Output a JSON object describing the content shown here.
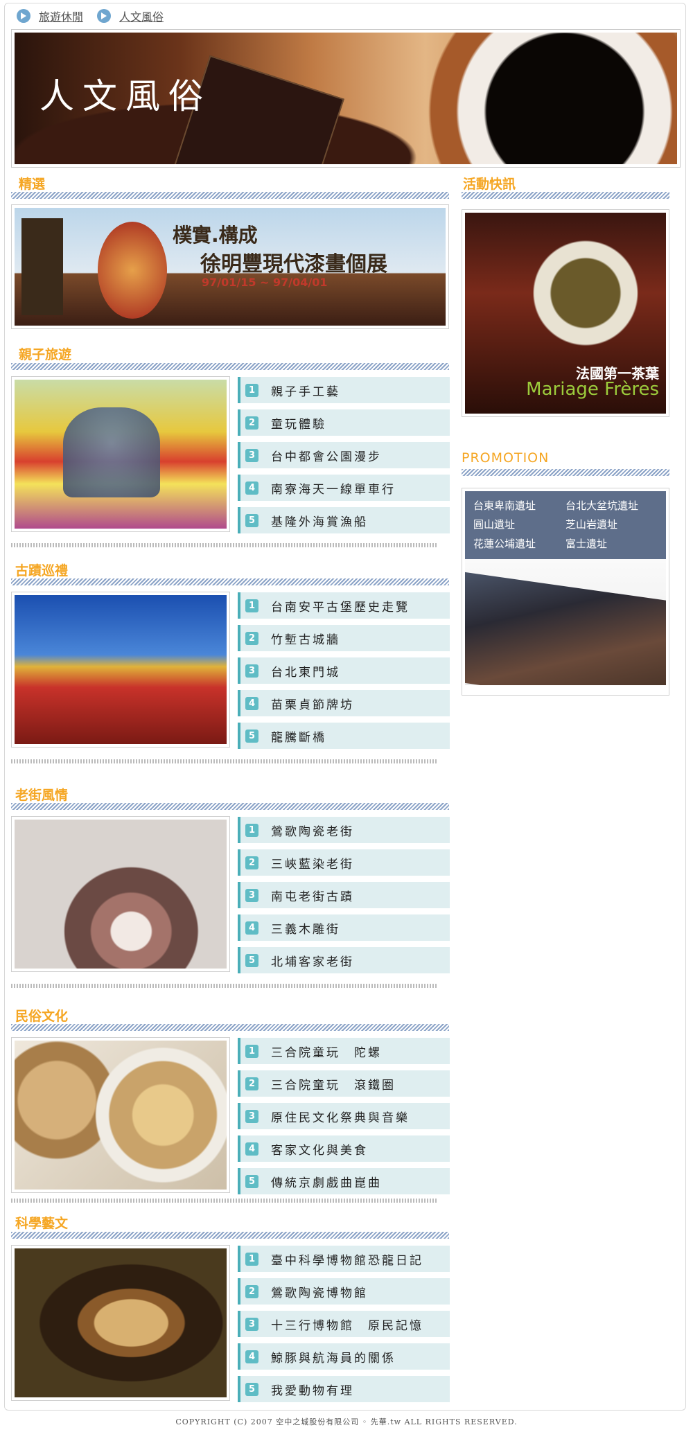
{
  "breadcrumb": {
    "items": [
      "旅遊休閒",
      "人文風俗"
    ]
  },
  "hero": {
    "title": "人文風俗"
  },
  "featured": {
    "title": "精選",
    "banner_line1": "樸實.構成",
    "banner_line2": "徐明豐現代漆畫個展",
    "banner_dates": "97/01/15 ~ 97/04/01"
  },
  "sections": [
    {
      "title": "親子旅遊",
      "items": [
        "親子手工藝",
        "童玩體驗",
        "台中都會公園漫步",
        "南寮海天一線單車行",
        "基隆外海賞漁船"
      ]
    },
    {
      "title": "古蹟巡禮",
      "items": [
        "台南安平古堡歷史走覽",
        "竹塹古城牆",
        "台北東門城",
        "苗栗貞節牌坊",
        "龍騰斷橋"
      ]
    },
    {
      "title": "老街風情",
      "items": [
        "鶯歌陶瓷老街",
        "三峽藍染老街",
        "南屯老街古蹟",
        "三義木雕街",
        "北埔客家老街"
      ]
    },
    {
      "title": "民俗文化",
      "items": [
        "三合院童玩　陀螺",
        "三合院童玩　滾鐵圈",
        "原住民文化祭典與音樂",
        "客家文化與美食",
        "傳統京劇戲曲崑曲"
      ]
    },
    {
      "title": "科學藝文",
      "items": [
        "臺中科學博物館恐龍日記",
        "鶯歌陶瓷博物館",
        "十三行博物館　原民記憶",
        "鯨豚與航海員的關係",
        "我愛動物有理"
      ]
    }
  ],
  "numbers": [
    "1",
    "2",
    "3",
    "4",
    "5"
  ],
  "sidebar": {
    "news_title": "活動快訊",
    "news_caption1": "法國第一茶葉",
    "news_caption2": "Mariage Frères",
    "promo_title": "PROMOTION",
    "promo_links": [
      "台東卑南遺址",
      "台北大坌坑遺址",
      "圓山遺址",
      "芝山岩遺址",
      "花蓮公埔遺址",
      "富士遺址"
    ]
  },
  "footer": {
    "text": "COPYRIGHT (C) 2007 空中之城股份有限公司 ◦ 先華.tw ALL RIGHTS RESERVED."
  },
  "colors": {
    "section_title": "#f5a623",
    "item_bg": "#dfeef0",
    "item_accent": "#5fbcc5",
    "promo_bg": "#5e6e8a"
  }
}
